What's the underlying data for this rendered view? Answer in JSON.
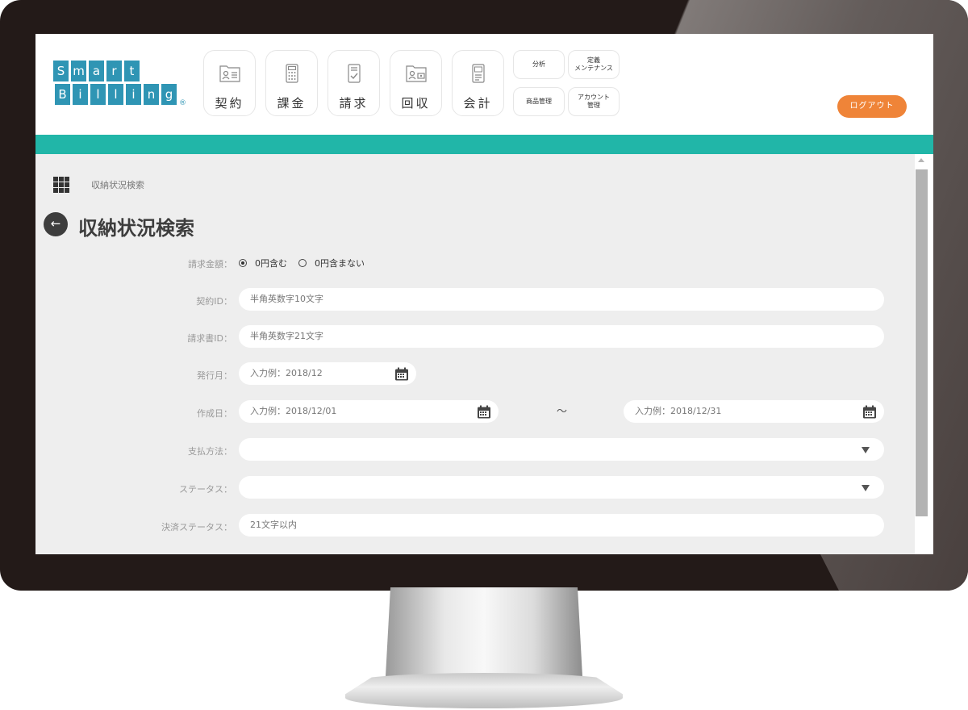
{
  "logo": {
    "row1": [
      "S",
      "m",
      "a",
      "r",
      "t"
    ],
    "row2": [
      "B",
      "i",
      "l",
      "l",
      "i",
      "n",
      "g"
    ],
    "reg": "®"
  },
  "nav": [
    {
      "label": "契約",
      "icon": "contract-icon"
    },
    {
      "label": "課金",
      "icon": "calculator-icon"
    },
    {
      "label": "請求",
      "icon": "invoice-icon"
    },
    {
      "label": "回収",
      "icon": "collection-icon"
    },
    {
      "label": "会計",
      "icon": "accounting-icon"
    }
  ],
  "small_nav": {
    "analysis": "分析",
    "maintenance_1": "定義",
    "maintenance_2": "メンテナンス",
    "products": "商品管理",
    "account_1": "アカウント",
    "account_2": "管理"
  },
  "logout": "ログアウト",
  "breadcrumb": "収納状況検索",
  "page_title": "収納状況検索",
  "form": {
    "amount_label": "請求金額：",
    "amount_options": [
      "0円含む",
      "0円含まない"
    ],
    "amount_selected": "0円含む",
    "contract_label": "契約ID：",
    "contract_placeholder": "半角英数字10文字",
    "invoice_label": "請求書ID：",
    "invoice_placeholder": "半角英数字21文字",
    "issue_month_label": "発行月：",
    "issue_month_placeholder": "入力例：2018/12",
    "created_label": "作成日：",
    "created_from_placeholder": "入力例：2018/12/01",
    "range_separator": "～",
    "created_to_placeholder": "入力例：2018/12/31",
    "payment_label": "支払方法：",
    "payment_value": "",
    "status_label": "ステータス：",
    "status_value": "",
    "settlement_label": "決済ステータス：",
    "settlement_placeholder": "21文字以内"
  },
  "colors": {
    "brand_blue": "#2f95b4",
    "teal_bar": "#21b6a8",
    "logout_orange": "#ef8438",
    "content_bg": "#eeeeee"
  }
}
